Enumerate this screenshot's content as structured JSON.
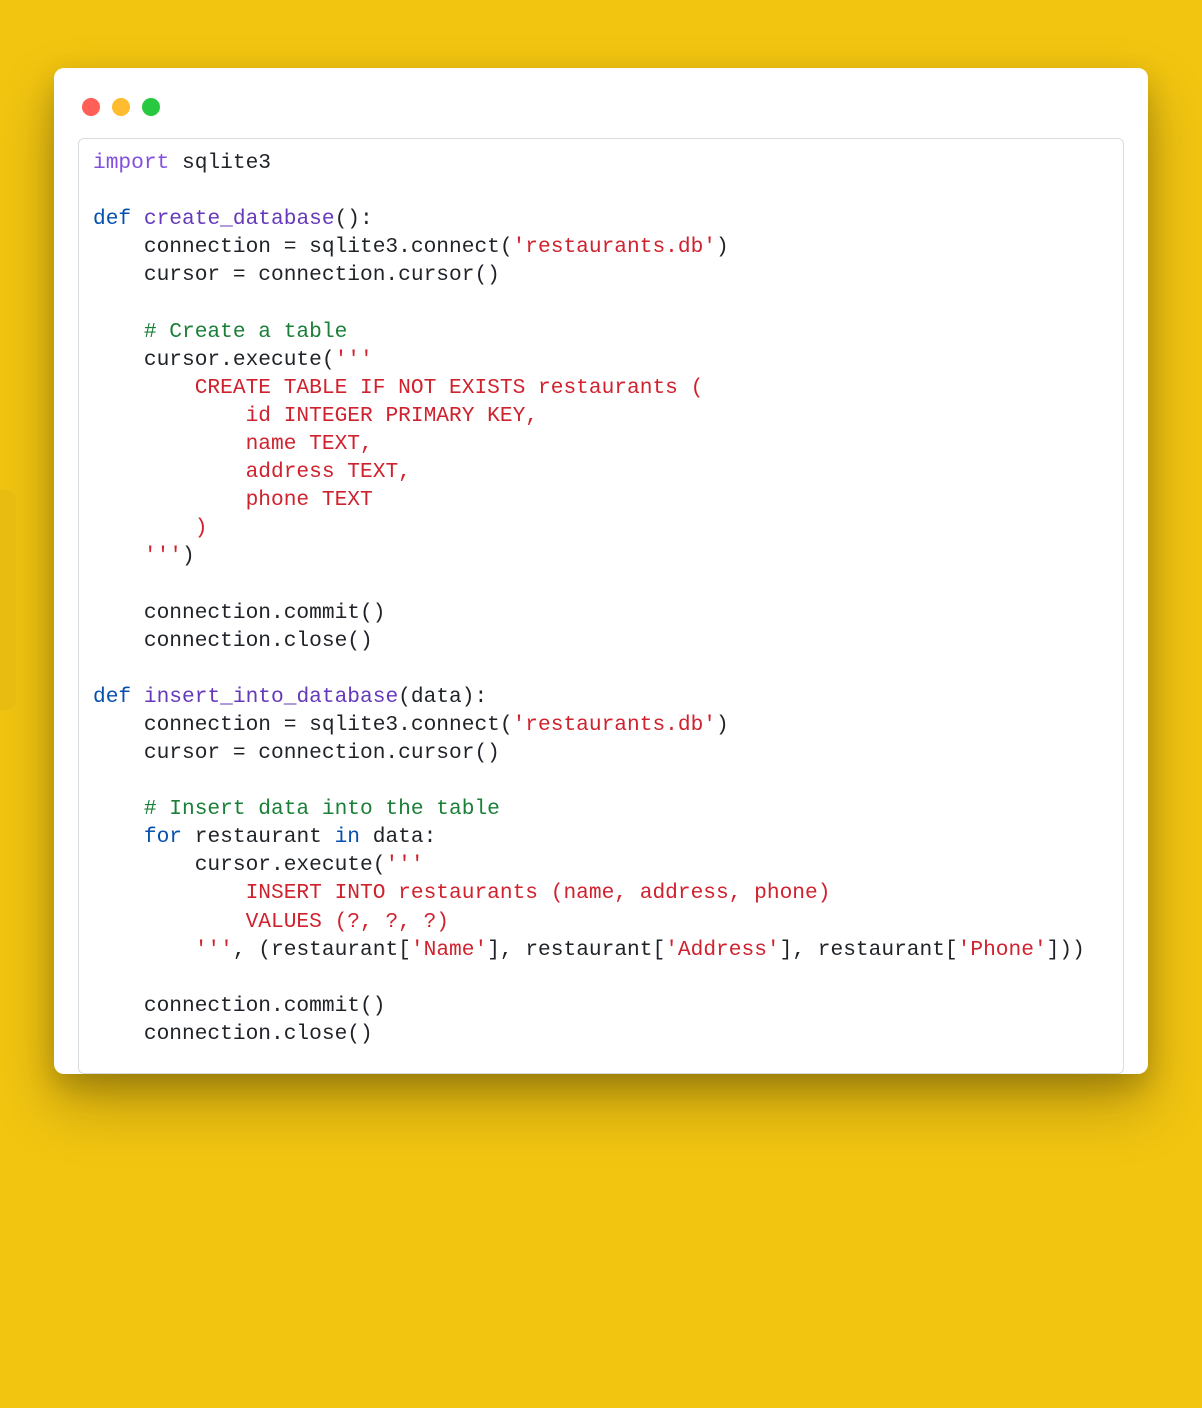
{
  "code": {
    "tokens": [
      {
        "cls": "kw-import",
        "txt": "import"
      },
      {
        "txt": " sqlite3\n"
      },
      {
        "txt": "\n"
      },
      {
        "cls": "kw-blue",
        "txt": "def"
      },
      {
        "txt": " "
      },
      {
        "cls": "fn-name",
        "txt": "create_database"
      },
      {
        "txt": "():\n"
      },
      {
        "txt": "    connection = sqlite3.connect("
      },
      {
        "cls": "string",
        "txt": "'restaurants.db'"
      },
      {
        "txt": ")\n"
      },
      {
        "txt": "    cursor = connection.cursor()\n"
      },
      {
        "txt": "\n"
      },
      {
        "txt": "    "
      },
      {
        "cls": "comment",
        "txt": "# Create a table"
      },
      {
        "txt": "\n"
      },
      {
        "txt": "    cursor.execute("
      },
      {
        "cls": "string",
        "txt": "'''\n        CREATE TABLE IF NOT EXISTS restaurants (\n            id INTEGER PRIMARY KEY,\n            name TEXT,\n            address TEXT,\n            phone TEXT\n        )\n    '''"
      },
      {
        "txt": ")\n"
      },
      {
        "txt": "\n"
      },
      {
        "txt": "    connection.commit()\n"
      },
      {
        "txt": "    connection.close()\n"
      },
      {
        "txt": "\n"
      },
      {
        "cls": "kw-blue",
        "txt": "def"
      },
      {
        "txt": " "
      },
      {
        "cls": "fn-name",
        "txt": "insert_into_database"
      },
      {
        "txt": "(data):\n"
      },
      {
        "txt": "    connection = sqlite3.connect("
      },
      {
        "cls": "string",
        "txt": "'restaurants.db'"
      },
      {
        "txt": ")\n"
      },
      {
        "txt": "    cursor = connection.cursor()\n"
      },
      {
        "txt": "\n"
      },
      {
        "txt": "    "
      },
      {
        "cls": "comment",
        "txt": "# Insert data into the table"
      },
      {
        "txt": "\n"
      },
      {
        "txt": "    "
      },
      {
        "cls": "kw-blue",
        "txt": "for"
      },
      {
        "txt": " restaurant "
      },
      {
        "cls": "kw-blue",
        "txt": "in"
      },
      {
        "txt": " data:\n"
      },
      {
        "txt": "        cursor.execute("
      },
      {
        "cls": "string",
        "txt": "'''\n            INSERT INTO restaurants (name, address, phone)\n            VALUES (?, ?, ?)\n        '''"
      },
      {
        "txt": ", (restaurant["
      },
      {
        "cls": "string",
        "txt": "'Name'"
      },
      {
        "txt": "], restaurant["
      },
      {
        "cls": "string",
        "txt": "'Address'"
      },
      {
        "txt": "], restaurant["
      },
      {
        "cls": "string",
        "txt": "'Phone'"
      },
      {
        "txt": "]))\n"
      },
      {
        "txt": "\n"
      },
      {
        "txt": "    connection.commit()\n"
      },
      {
        "txt": "    connection.close()\n"
      }
    ]
  }
}
